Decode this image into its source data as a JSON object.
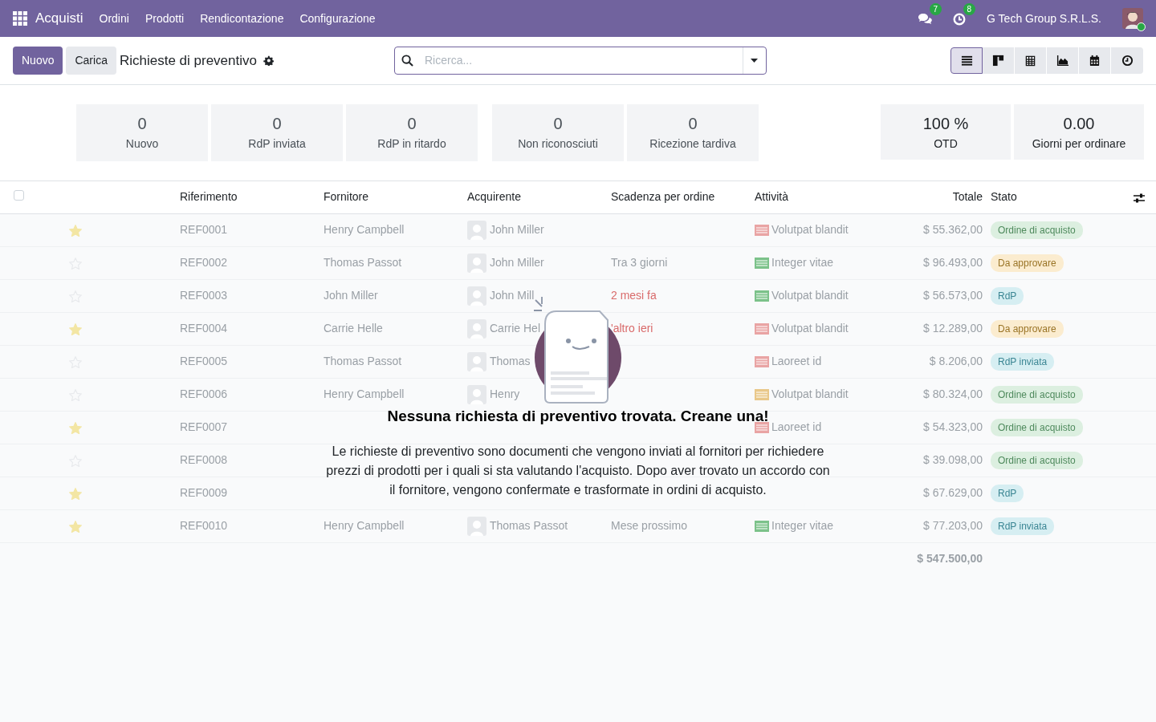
{
  "navbar": {
    "app": "Acquisti",
    "menus": [
      "Ordini",
      "Prodotti",
      "Rendicontazione",
      "Configurazione"
    ],
    "messages_count": "7",
    "activities_count": "8",
    "company": "G Tech Group S.R.L.S."
  },
  "control_panel": {
    "new_button": "Nuovo",
    "upload_button": "Carica",
    "title": "Richieste di preventivo",
    "search": {
      "placeholder": "Ricerca..."
    },
    "views": [
      {
        "kind": "list",
        "selected": true
      },
      {
        "kind": "kanban",
        "selected": false
      },
      {
        "kind": "pivot",
        "selected": false
      },
      {
        "kind": "graph",
        "selected": false
      },
      {
        "kind": "calendar",
        "selected": false
      },
      {
        "kind": "activity",
        "selected": false
      }
    ]
  },
  "dashboard": [
    [
      {
        "value": "0",
        "label": "Nuovo"
      },
      {
        "value": "0",
        "label": "RdP inviata"
      },
      {
        "value": "0",
        "label": "RdP in ritardo"
      }
    ],
    [
      {
        "value": "0",
        "label": "Non riconosciuti"
      },
      {
        "value": "0",
        "label": "Ricezione tardiva"
      }
    ],
    [
      {
        "value": "100 %",
        "label": "OTD"
      },
      {
        "value": "0.00",
        "label": "Giorni per ordinare"
      }
    ]
  ],
  "table": {
    "select_all": {
      "checked": false
    },
    "columns": [
      "Riferimento",
      "Fornitore",
      "Acquirente",
      "Scadenza per ordine",
      "Attività",
      "Totale",
      "Stato"
    ],
    "rows": [
      {
        "starred": true,
        "reference": "REF0001",
        "vendor": "Henry Campbell",
        "buyer": "John Miller",
        "activity": {
          "label": "Volutpat blandit",
          "color": "#e9a4a4"
        },
        "total": "$ 55.362,00",
        "status": {
          "label": "Ordine di acquisto",
          "kind": "purchase"
        }
      },
      {
        "starred": false,
        "reference": "REF0002",
        "vendor": "Thomas Passot",
        "buyer": "John Miller",
        "deadline": "Tra 3 giorni",
        "overdue": false,
        "activity": {
          "label": "Integer vitae",
          "color": "#7cc28a"
        },
        "total": "$ 96.493,00",
        "status": {
          "label": "Da approvare",
          "kind": "to_approve"
        }
      },
      {
        "starred": false,
        "reference": "REF0003",
        "vendor": "John Miller",
        "buyer": "John Mill",
        "deadline": "2 mesi fa",
        "overdue": true,
        "activity": {
          "label": "Volutpat blandit",
          "color": "#7cc28a"
        },
        "total": "$ 56.573,00",
        "status": {
          "label": "RdP",
          "kind": "rfq"
        }
      },
      {
        "starred": true,
        "reference": "REF0004",
        "vendor": "Carrie Helle",
        "buyer": "Carrie Hel",
        "deadline": "'altro ieri",
        "overdue": true,
        "activity": {
          "label": "Volutpat blandit",
          "color": "#e9a4a4"
        },
        "total": "$ 12.289,00",
        "status": {
          "label": "Da approvare",
          "kind": "to_approve"
        }
      },
      {
        "starred": false,
        "reference": "REF0005",
        "vendor": "Thomas Passot",
        "buyer": "Thomas",
        "activity": {
          "label": "Laoreet id",
          "color": "#e9a4a4"
        },
        "total": "$ 8.206,00",
        "status": {
          "label": "RdP inviata",
          "kind": "rfq"
        }
      },
      {
        "starred": false,
        "reference": "REF0006",
        "vendor": "Henry Campbell",
        "buyer": "Henry",
        "activity": {
          "label": "Volutpat blandit",
          "color": "#e9c88a"
        },
        "total": "$ 80.324,00",
        "status": {
          "label": "Ordine di acquisto",
          "kind": "purchase"
        }
      },
      {
        "starred": true,
        "reference": "REF0007",
        "activity": {
          "label": "Laoreet id",
          "color": "#e9a4a4"
        },
        "total": "$ 54.323,00",
        "status": {
          "label": "Ordine di acquisto",
          "kind": "purchase"
        }
      },
      {
        "starred": false,
        "reference": "REF0008",
        "total": "$ 39.098,00",
        "status": {
          "label": "Ordine di acquisto",
          "kind": "purchase"
        }
      },
      {
        "starred": true,
        "reference": "REF0009",
        "total": "$ 67.629,00",
        "status": {
          "label": "RdP",
          "kind": "rfq"
        }
      },
      {
        "starred": true,
        "reference": "REF0010",
        "vendor": "Henry Campbell",
        "buyer": "Thomas Passot",
        "deadline": "Mese prossimo",
        "overdue": false,
        "activity": {
          "label": "Integer vitae",
          "color": "#7cc28a"
        },
        "total": "$ 77.203,00",
        "status": {
          "label": "RdP inviata",
          "kind": "rfq"
        }
      }
    ],
    "grand_total": "$ 547.500,00"
  },
  "empty_state": {
    "title": "Nessuna richiesta di preventivo trovata. Creane una!",
    "text": "Le richieste di preventivo sono documenti che vengono inviati al fornitori per richiedere prezzi di prodotti per i quali si sta valutando l'acquisto. Dopo aver trovato un accordo con il fornitore, vengono confermate e trasformate in ordini di acquisto."
  }
}
